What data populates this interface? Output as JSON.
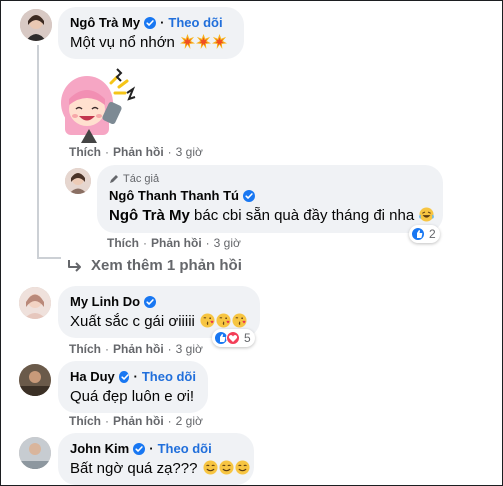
{
  "comments": [
    {
      "name": "Ngô Trà My",
      "follow": "Theo dõi",
      "text": "Một vụ nổ nhớn",
      "emoji": "boom-emoji",
      "actions": {
        "like": "Thích",
        "reply": "Phản hồi",
        "time": "3 giờ"
      }
    },
    {
      "badge": "Tác giả",
      "name": "Ngô Thanh Thanh Tú",
      "mention": "Ngô Trà My",
      "text": " bác cbi sẵn quà đầy tháng đi nha",
      "actions": {
        "like": "Thích",
        "reply": "Phản hồi",
        "time": "3 giờ"
      },
      "reaction_count": "2"
    },
    {
      "name": "My Linh Do",
      "text": "Xuất sắc c gái ơiiiii",
      "actions": {
        "like": "Thích",
        "reply": "Phản hồi",
        "time": "3 giờ"
      },
      "reaction_count": "5"
    },
    {
      "name": "Ha Duy",
      "follow": "Theo dõi",
      "text": "Quá đẹp luôn e ơi!",
      "actions": {
        "like": "Thích",
        "reply": "Phản hồi",
        "time": "2 giờ"
      }
    },
    {
      "name": "John Kim",
      "follow": "Theo dõi",
      "text": "Bất ngờ quá zạ???"
    }
  ],
  "view_more": "Xem thêm 1 phản hồi",
  "colors": {
    "bubble": "#f0f2f5",
    "link": "#216fdb",
    "verified": "#1877f2",
    "meta": "#65676b"
  }
}
